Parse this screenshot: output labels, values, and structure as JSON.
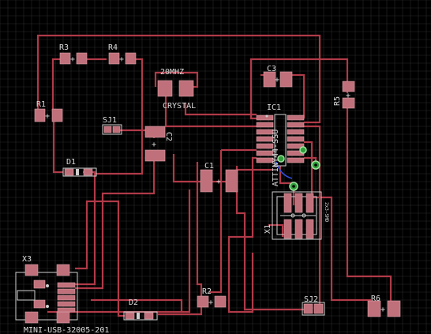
{
  "board": {
    "grid_color": "#2a2a2a",
    "trace_color": "#b03a48",
    "pad_color": "#c0707a",
    "silk_color": "#d0d0d0",
    "via_color": "#2f9e3a",
    "background": "#000000"
  },
  "labels": {
    "r3": "R3",
    "r4": "R4",
    "r1": "R1",
    "r5": "R5",
    "r2": "R2",
    "r6": "R6",
    "sj1": "SJ1",
    "sj2": "SJ2",
    "d1": "D1",
    "d2": "D2",
    "c1": "C1",
    "c2": "C2",
    "c3": "C3",
    "ic1": "IC1",
    "ic1_part": "ATTINY44-SSU",
    "crystal_value": "20MHZ",
    "crystal_label": "CRYSTAL",
    "x1": "X1",
    "x1_part": "2x3-SMD",
    "x3": "X3",
    "usb_part": "MINI-USB-32005-201"
  }
}
